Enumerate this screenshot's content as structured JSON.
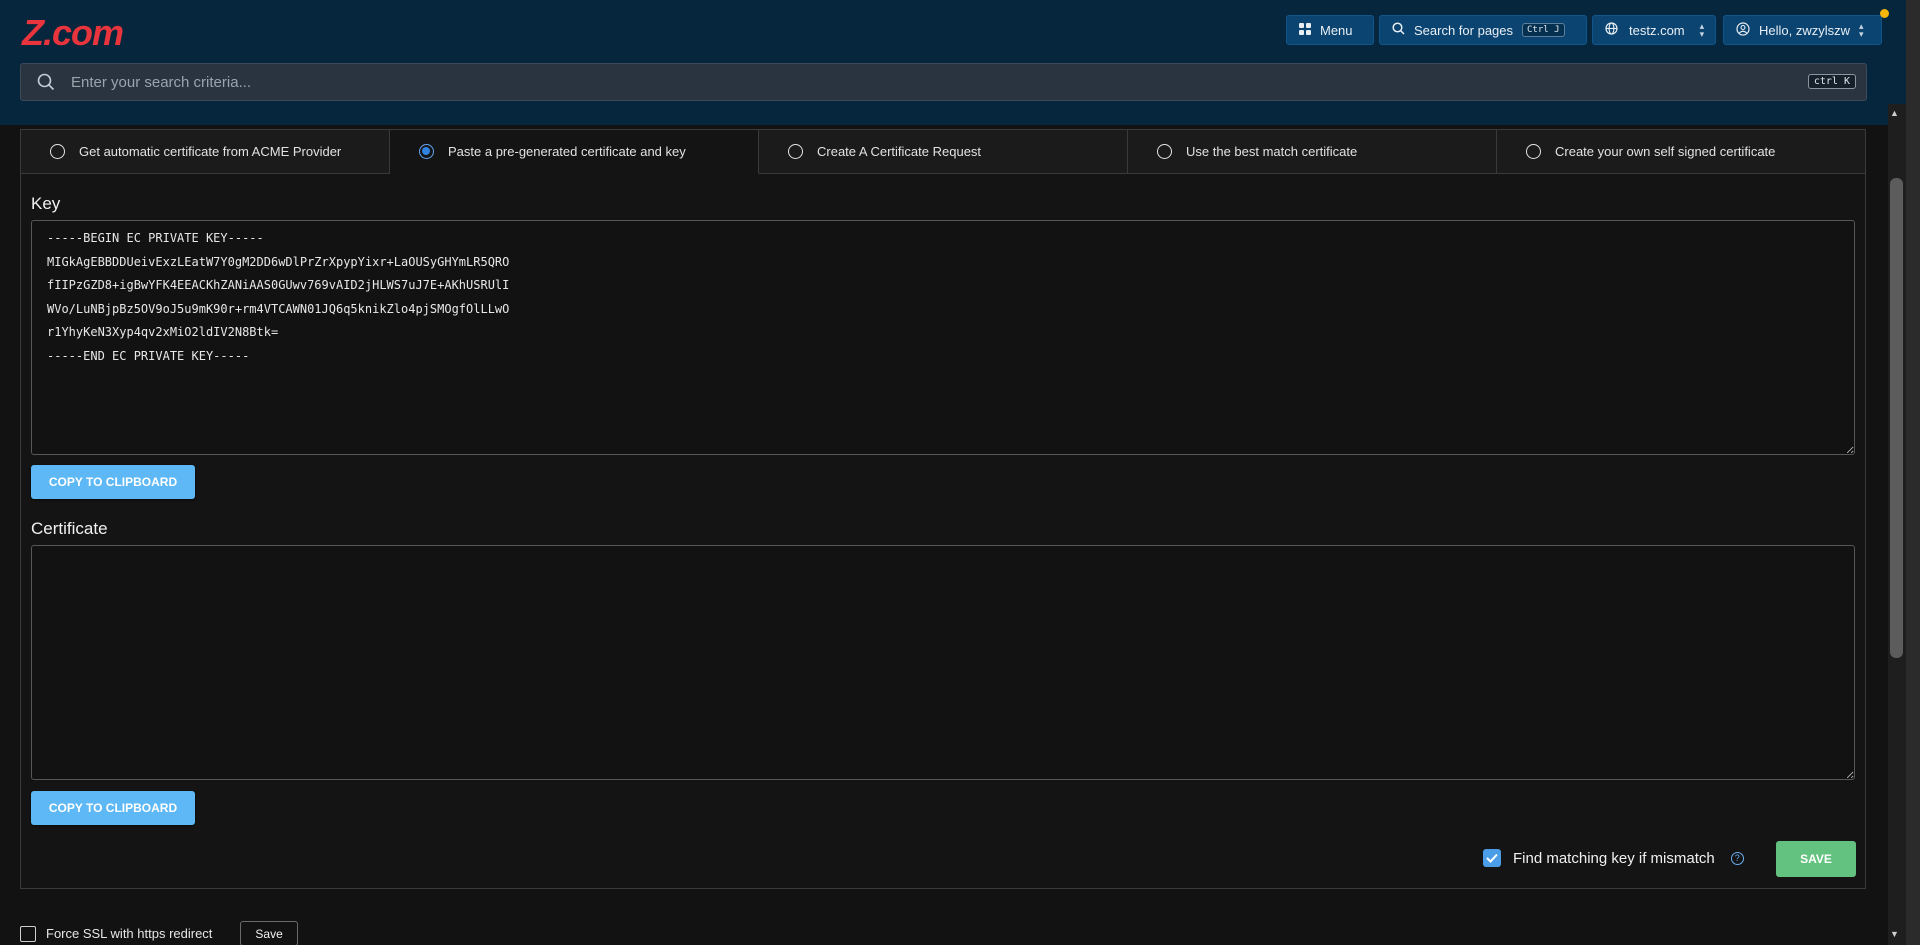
{
  "brand": {
    "logo_text": "Z.com",
    "logo_color": "#e8343c"
  },
  "header": {
    "menu_label": "Menu",
    "search_pages_label": "Search for pages",
    "search_pages_shortcut": "Ctrl J",
    "domain_label": "testz.com",
    "user_label": "Hello, zwzylszw"
  },
  "search": {
    "placeholder": "Enter your search criteria...",
    "shortcut": "ctrl K"
  },
  "tabs": [
    {
      "label": "Get automatic certificate from ACME Provider",
      "selected": false
    },
    {
      "label": "Paste a pre-generated certificate and key",
      "selected": true
    },
    {
      "label": "Create A Certificate Request",
      "selected": false
    },
    {
      "label": "Use the best match certificate",
      "selected": false
    },
    {
      "label": "Create your own self signed certificate",
      "selected": false
    }
  ],
  "key_section": {
    "label": "Key",
    "value": "-----BEGIN EC PRIVATE KEY-----\nMIGkAgEBBDDUeivExzLEatW7Y0gM2DD6wDlPrZrXpypYixr+LaOUSyGHYmLR5QRO\nfIIPzGZD8+igBwYFK4EEACKhZANiAAS0GUwv769vAID2jHLWS7uJ7E+AKhUSRUlI\nWVo/LuNBjpBz5OV9oJ5u9mK90r+rm4VTCAWN01JQ6q5knikZlo4pjSMOgfOlLLwO\nr1YhyKeN3Xyp4qv2xMiO2ldIV2N8Btk=\n-----END EC PRIVATE KEY-----",
    "copy_label": "COPY TO CLIPBOARD"
  },
  "certificate_section": {
    "label": "Certificate",
    "value": "",
    "copy_label": "COPY TO CLIPBOARD"
  },
  "find_matching": {
    "label": "Find matching key if mismatch",
    "checked": true,
    "help": "?"
  },
  "save_label": "SAVE",
  "force_ssl": {
    "label": "Force SSL with https redirect",
    "checked": false,
    "save_label": "Save"
  },
  "colors": {
    "header_bg": "#06263d",
    "accent_blue": "#5db8f5",
    "save_green": "#63c27f",
    "notification": "#f5b50a"
  }
}
